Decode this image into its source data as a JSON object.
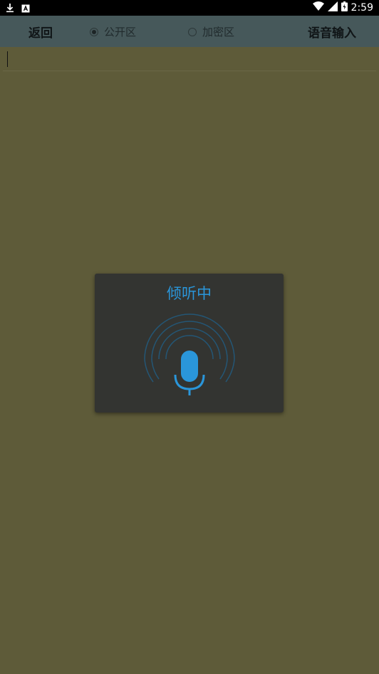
{
  "status_bar": {
    "time": "2:59",
    "left_icons": [
      "download-icon",
      "a-box-icon"
    ],
    "right_icons": [
      "wifi-icon",
      "signal-icon",
      "battery-icon"
    ]
  },
  "toolbar": {
    "back_label": "返回",
    "public_label": "公开区",
    "encrypted_label": "加密区",
    "voice_input_label": "语音输入",
    "selected_zone": "公开区"
  },
  "editor": {
    "value": ""
  },
  "dialog": {
    "title": "倾听中",
    "icon": "microphone-icon"
  },
  "colors": {
    "background": "#5e5b39",
    "toolbar": "#46585a",
    "dialog_bg": "#333431",
    "accent": "#2a96da"
  }
}
